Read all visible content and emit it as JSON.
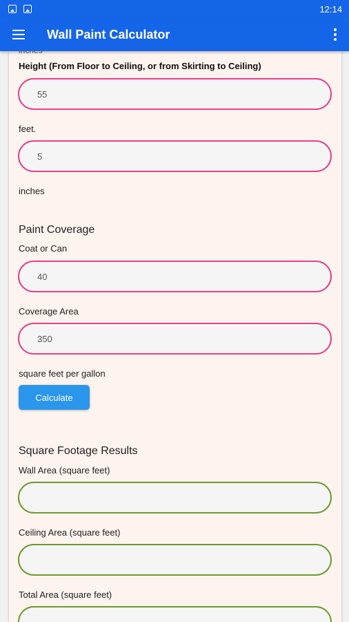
{
  "status_bar": {
    "time": "12:14"
  },
  "app_bar": {
    "title": "Wall Paint Calculator"
  },
  "form": {
    "cut_label": "inches",
    "height_label": "Height (From Floor to Ceiling, or from Skirting to Ceiling)",
    "height_feet_value": "55",
    "feet_label": "feet.",
    "height_inches_value": "5",
    "inches_label": "inches",
    "paint_coverage_title": "Paint Coverage",
    "coat_label": "Coat or Can",
    "coat_value": "40",
    "coverage_area_label": "Coverage Area",
    "coverage_area_value": "350",
    "coverage_unit_label": "square feet per gallon",
    "calculate_label": "Calculate"
  },
  "results": {
    "title": "Square Footage Results",
    "wall_area_label": "Wall Area (square feet)",
    "wall_area_value": "",
    "ceiling_area_label": "Ceiling Area (square feet)",
    "ceiling_area_value": "",
    "total_area_label": "Total Area (square feet)",
    "total_area_value": ""
  },
  "colors": {
    "primary": "#1565e8",
    "input_border": "#e83f87",
    "result_border": "#6a9a2c",
    "button": "#2a96ec",
    "card_background": "#fdf3ef"
  }
}
